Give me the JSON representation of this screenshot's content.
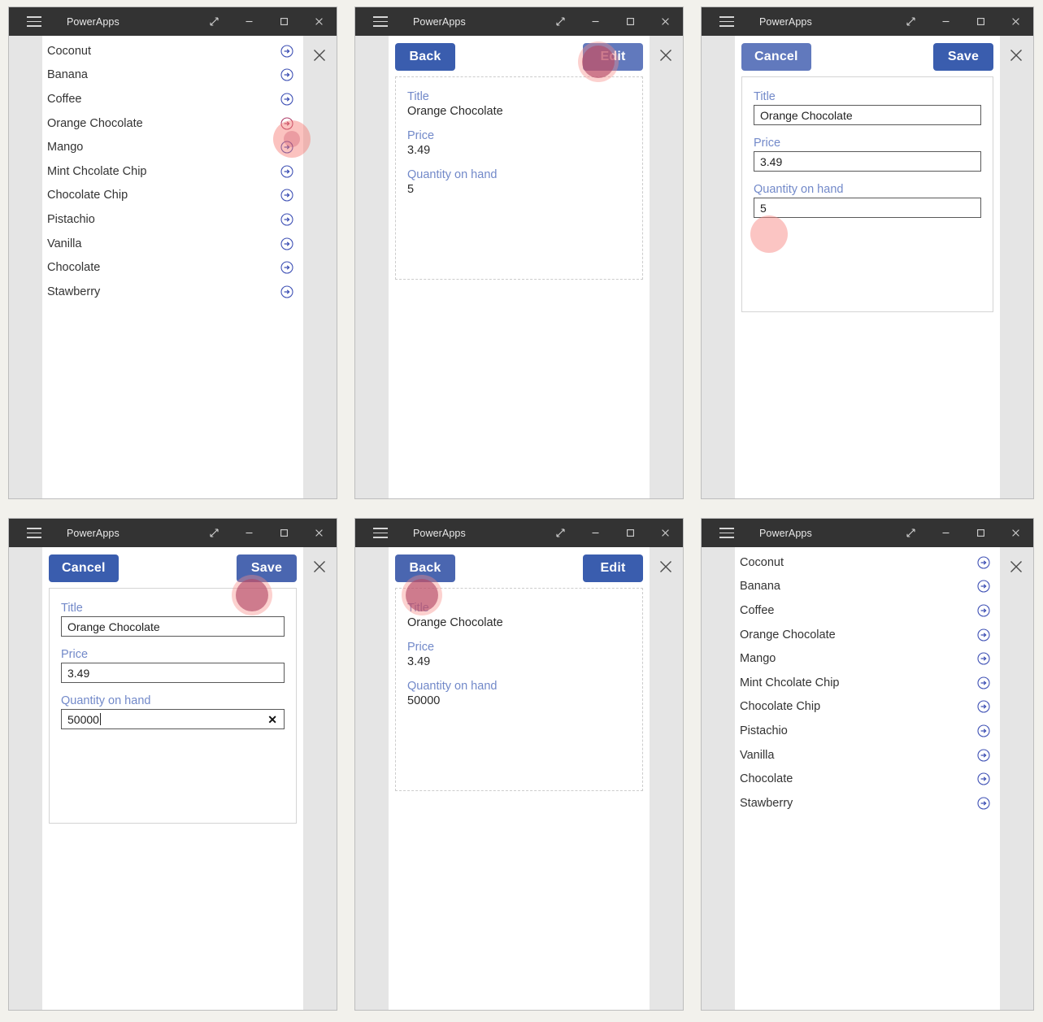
{
  "window": {
    "title": "PowerApps",
    "menu_icon": "hamburger-icon",
    "controls": [
      {
        "name": "restore-icon",
        "label": "Restore"
      },
      {
        "name": "minimize-icon",
        "label": "Minimize"
      },
      {
        "name": "maximize-icon",
        "label": "Maximize"
      },
      {
        "name": "close-icon",
        "label": "Close"
      }
    ],
    "stage_close_icon": "close-icon"
  },
  "colors": {
    "titlebar_bg": "#333333",
    "button_blue": "#3a5dae",
    "label_blue": "#7289c9",
    "chevron_blue": "#3f51b5",
    "highlight_halo": "#f77872",
    "highlight_core": "#d73c50",
    "canvas_white": "#ffffff",
    "stage_gray": "#e5e5e5",
    "page_bg": "#f2f1ec"
  },
  "list": {
    "items": [
      {
        "label": "Coconut",
        "icon": "arrow-right-circle-icon"
      },
      {
        "label": "Banana",
        "icon": "arrow-right-circle-icon"
      },
      {
        "label": "Coffee",
        "icon": "arrow-right-circle-icon"
      },
      {
        "label": "Orange Chocolate",
        "icon": "arrow-right-circle-icon"
      },
      {
        "label": "Mango",
        "icon": "arrow-right-circle-icon"
      },
      {
        "label": "Mint Chcolate Chip",
        "icon": "arrow-right-circle-icon"
      },
      {
        "label": "Chocolate Chip",
        "icon": "arrow-right-circle-icon"
      },
      {
        "label": "Pistachio",
        "icon": "arrow-right-circle-icon"
      },
      {
        "label": "Vanilla",
        "icon": "arrow-right-circle-icon"
      },
      {
        "label": "Chocolate",
        "icon": "arrow-right-circle-icon"
      },
      {
        "label": "Stawberry",
        "icon": "arrow-right-circle-icon"
      }
    ]
  },
  "buttons": {
    "back": "Back",
    "edit": "Edit",
    "cancel": "Cancel",
    "save": "Save",
    "clear": "✕"
  },
  "fields": {
    "title_label": "Title",
    "price_label": "Price",
    "quantity_label": "Quantity on hand"
  },
  "record": {
    "title": "Orange Chocolate",
    "price": "3.49",
    "quantity_before": "5",
    "quantity_after": "50000"
  },
  "panels": [
    {
      "id": "panel-1",
      "name": "browse-screen-initial",
      "screen": "browse",
      "highlight": "list row Orange Chocolate chevron"
    },
    {
      "id": "panel-2",
      "name": "detail-screen-before-edit",
      "screen": "detail",
      "quantity": "5",
      "highlight": "Edit button"
    },
    {
      "id": "panel-3",
      "name": "edit-screen-initial",
      "screen": "edit",
      "quantity": "5",
      "highlight": "Quantity on hand input"
    },
    {
      "id": "panel-4",
      "name": "edit-screen-typed",
      "screen": "edit",
      "quantity": "50000",
      "highlight": "Save button"
    },
    {
      "id": "panel-5",
      "name": "detail-screen-after-save",
      "screen": "detail",
      "quantity": "50000",
      "highlight": "Back button"
    },
    {
      "id": "panel-6",
      "name": "browse-screen-final",
      "screen": "browse",
      "highlight": "none"
    }
  ]
}
